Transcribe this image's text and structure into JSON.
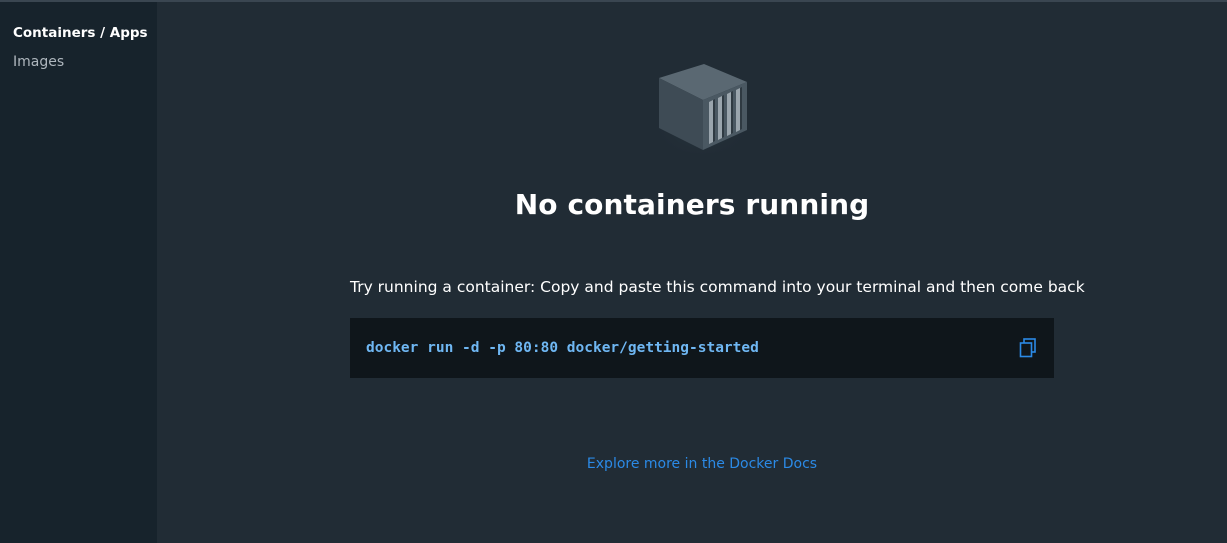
{
  "sidebar": {
    "items": [
      {
        "label": "Containers / Apps",
        "active": true
      },
      {
        "label": "Images",
        "active": false
      }
    ]
  },
  "main": {
    "icon": "container-icon",
    "title": "No containers running",
    "hint": "Try running a container: Copy and paste this command into your terminal and then come back",
    "command": "docker run -d -p 80:80 docker/getting-started",
    "copy_icon": "copy-icon",
    "docs_link": "Explore more in the Docker Docs"
  },
  "colors": {
    "background": "#212c35",
    "sidebar": "#17232c",
    "command_bg": "#0f161b",
    "command_text": "#6fb7f3",
    "link": "#2b8ae6"
  }
}
